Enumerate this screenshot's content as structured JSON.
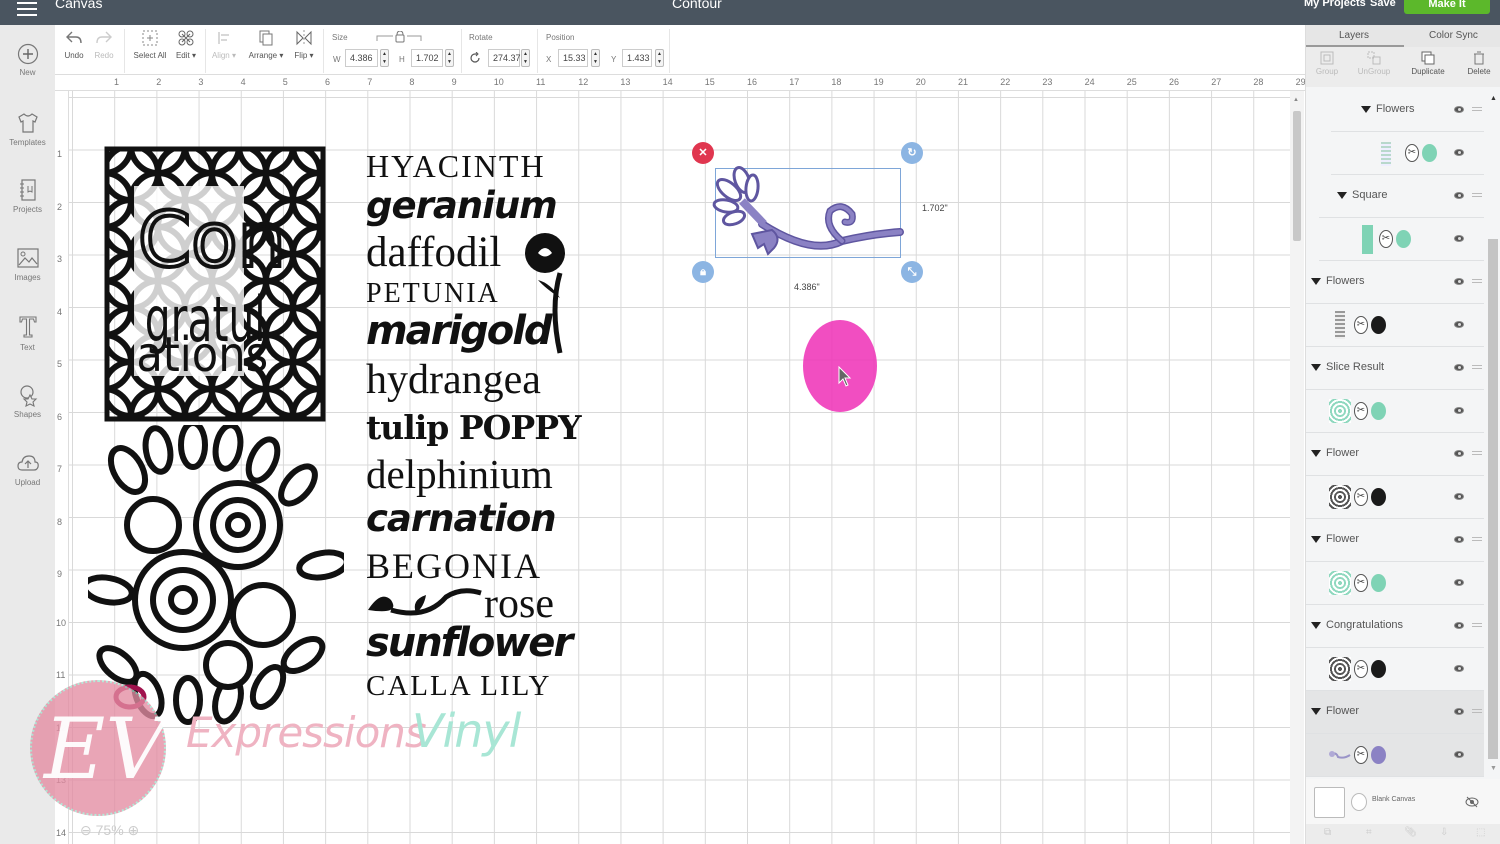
{
  "topbar": {
    "app_title": "Canvas",
    "doc_title": "Contour",
    "my_projects": "My Projects",
    "save": "Save",
    "make_it": "Make It"
  },
  "sidebar": {
    "items": [
      {
        "label": "New",
        "icon": "plus-circle-icon"
      },
      {
        "label": "Templates",
        "icon": "tshirt-icon"
      },
      {
        "label": "Projects",
        "icon": "notebook-icon"
      },
      {
        "label": "Images",
        "icon": "image-icon"
      },
      {
        "label": "Text",
        "icon": "text-t-icon"
      },
      {
        "label": "Shapes",
        "icon": "shapes-icon"
      },
      {
        "label": "Upload",
        "icon": "upload-cloud-icon"
      }
    ]
  },
  "toolbar": {
    "undo": "Undo",
    "redo": "Redo",
    "select_all": "Select All",
    "edit": "Edit",
    "align": "Align",
    "arrange": "Arrange",
    "flip": "Flip",
    "size_label": "Size",
    "w_label": "W",
    "w_value": "4.386",
    "h_label": "H",
    "h_value": "1.702",
    "rotate_label": "Rotate",
    "rotate_value": "274.37",
    "position_label": "Position",
    "x_label": "X",
    "x_value": "15.33",
    "y_label": "Y",
    "y_value": "1.433"
  },
  "ruler": {
    "top": [
      "1",
      "2",
      "3",
      "4",
      "5",
      "6",
      "7",
      "8",
      "9",
      "10",
      "11",
      "12",
      "13",
      "14",
      "15",
      "16",
      "17",
      "18",
      "19",
      "20",
      "21",
      "22",
      "23",
      "24",
      "25",
      "26",
      "27",
      "28",
      "29"
    ],
    "left": [
      "1",
      "2",
      "3",
      "4",
      "5",
      "6",
      "7",
      "8",
      "9",
      "10",
      "11",
      "12",
      "13",
      "14"
    ]
  },
  "canvas": {
    "congrats_art_text": "Con gratul ations",
    "flower_words": [
      "HYACINTH",
      "geranium",
      "daffodil",
      "PETUNIA",
      "marigold",
      "hydrangea",
      "tulip POPPY",
      "delphinium",
      "carnation",
      "BEGONIA",
      "rose",
      "sunflower",
      "CALLA LILY"
    ],
    "selection": {
      "width_label": "4.386\"",
      "height_label": "1.702\"",
      "color": "#8b82c4"
    },
    "watermark": {
      "monogram": "EV",
      "text1": "Expressions",
      "text2": "Vinyl"
    },
    "zoom_level": "75%"
  },
  "panel": {
    "tabs": [
      "Layers",
      "Color Sync"
    ],
    "active_tab": "Layers",
    "tools": [
      {
        "label": "Group",
        "enabled": false
      },
      {
        "label": "UnGroup",
        "enabled": false
      },
      {
        "label": "Duplicate",
        "enabled": true
      },
      {
        "label": "Delete",
        "enabled": true
      }
    ],
    "layers": [
      {
        "name": "Flowers",
        "color": "#7fd3b5"
      },
      {
        "name": "Square",
        "color": "#7fd3b5"
      },
      {
        "name": "Flowers",
        "color": "#1a1a1a"
      },
      {
        "name": "Slice Result",
        "color": "#7fd3b5"
      },
      {
        "name": "Flower",
        "color": "#1a1a1a"
      },
      {
        "name": "Flower",
        "color": "#7fd3b5"
      },
      {
        "name": "Congratulations",
        "color": "#1a1a1a"
      },
      {
        "name": "Flower",
        "color": "#8b82c4",
        "selected": true
      }
    ],
    "blank_canvas": "Blank Canvas"
  }
}
